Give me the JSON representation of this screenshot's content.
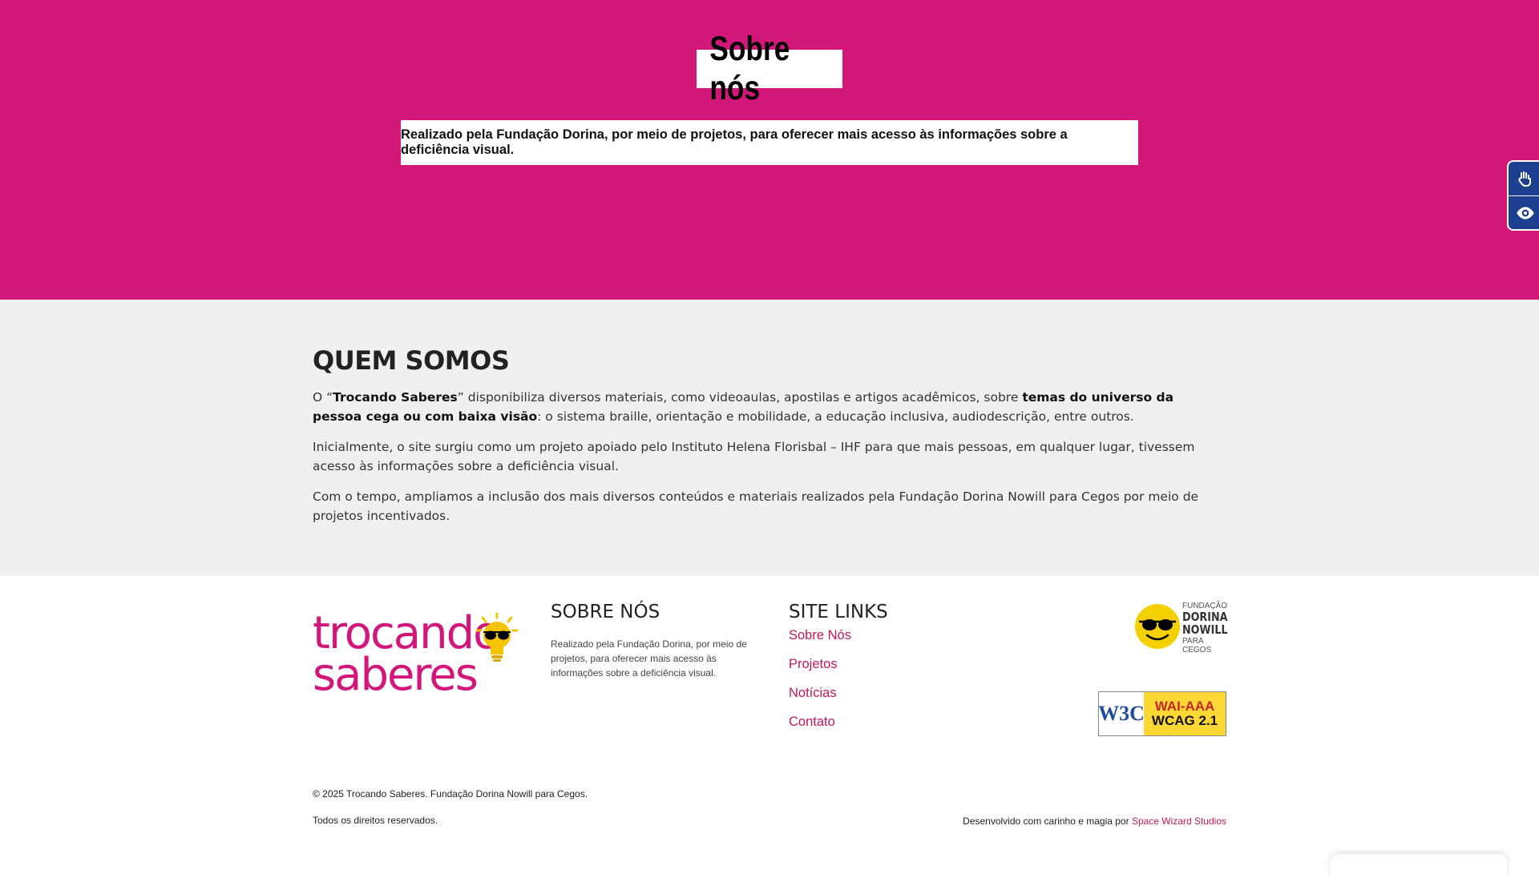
{
  "hero": {
    "title": "Sobre nós",
    "subtitle": "Realizado pela Fundação Dorina, por meio de projetos, para oferecer mais acesso às informações sobre a deficiência visual.",
    "background": "#d3177a"
  },
  "accessibility": {
    "items": [
      {
        "icon": "sign-language-icon"
      },
      {
        "icon": "eye-icon"
      }
    ],
    "color": "#1d3f8f"
  },
  "about": {
    "title": "QUEM SOMOS",
    "p1_a": "O “",
    "p1_b": "Trocando Saberes",
    "p1_c": "” disponibiliza diversos materiais, como videoaulas, apostilas e artigos acadêmicos, sobre ",
    "p1_d": "temas do universo da pessoa cega ou com baixa visão",
    "p1_e": ": o sistema braille, orientação e mobilidade, a educação inclusiva, audiodescrição, entre outros.",
    "p2": "Inicialmente, o site surgiu como um projeto apoiado pelo Instituto Helena Florisbal – IHF para que mais pessoas, em qualquer lugar, tivessem acesso às informações sobre a deficiência visual.",
    "p3": "Com o tempo, ampliamos a inclusão dos mais diversos conteúdos e materiais realizados pela Fundação Dorina Nowill para Cegos por meio de projetos incentivados."
  },
  "footer": {
    "logo_line1": "trocando",
    "logo_line2": "saberes",
    "about_title": "SOBRE NÓS",
    "about_desc": "Realizado pela Fundação Dorina, por meio de projetos, para oferecer mais acesso às informações sobre a deficiência visual.",
    "links_title": "SITE LINKS",
    "links": [
      "Sobre Nós",
      "Projetos",
      "Notícias",
      "Contato"
    ],
    "fundacao": {
      "line1": "FUNDAÇÃO",
      "line2": "DORINA",
      "line3": "NOWILL",
      "line4": "PARA CEGOS"
    },
    "badge": {
      "w3c": "W3C",
      "level": "WAI-AAA",
      "wcag": "WCAG 2.1"
    },
    "copyright": "© 2025 Trocando Saberes. Fundação Dorina Nowill para Cegos.",
    "rights": "Todos os direitos reservados.",
    "credit_text": "Desenvolvido com carinho e magia por ",
    "credit_link": "Space Wizard Studios",
    "accent": "#c2185b"
  }
}
